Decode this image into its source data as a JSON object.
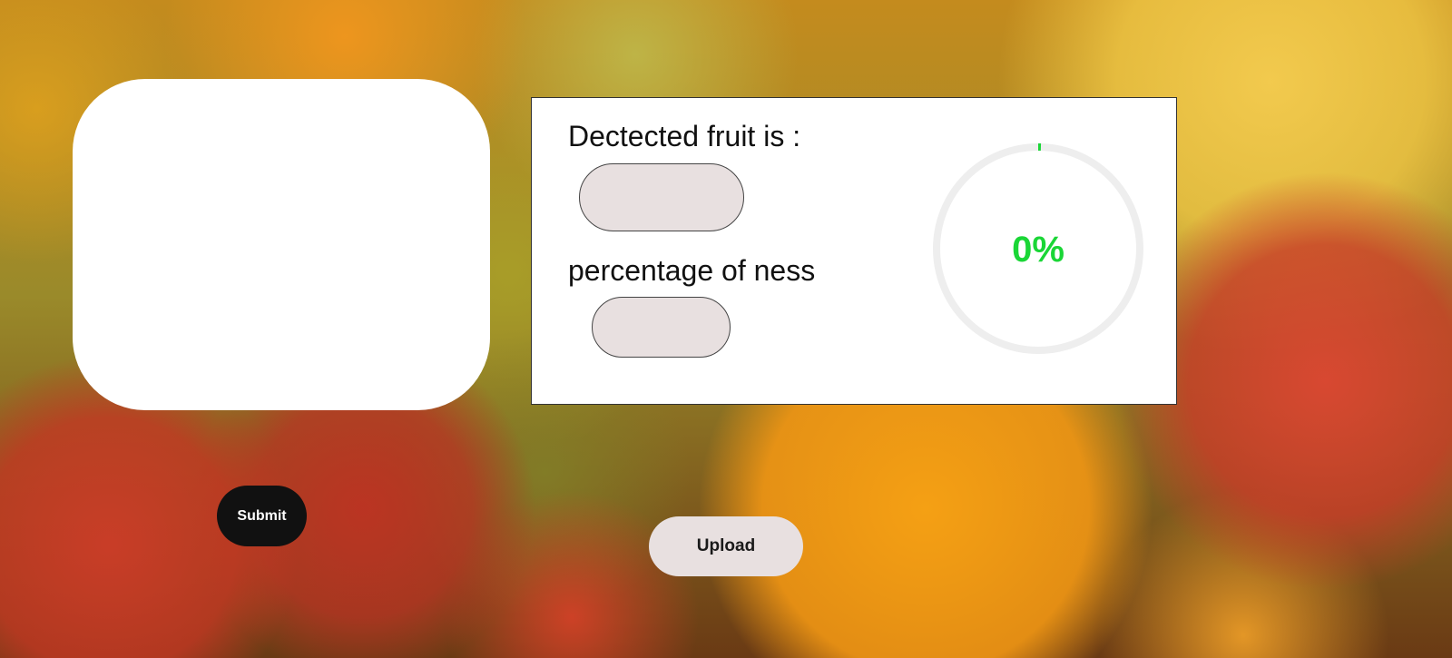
{
  "image_preview": {
    "background": "#ffffff"
  },
  "result": {
    "fruit_label": "Dectected fruit is :",
    "fruit_value": "",
    "ness_label": "percentage of ness",
    "ness_value": ""
  },
  "progress": {
    "text": "0%",
    "value_percent": 0,
    "color": "#1ad636",
    "track_color": "#eeeeee"
  },
  "buttons": {
    "submit_label": "Submit",
    "upload_label": "Upload"
  }
}
